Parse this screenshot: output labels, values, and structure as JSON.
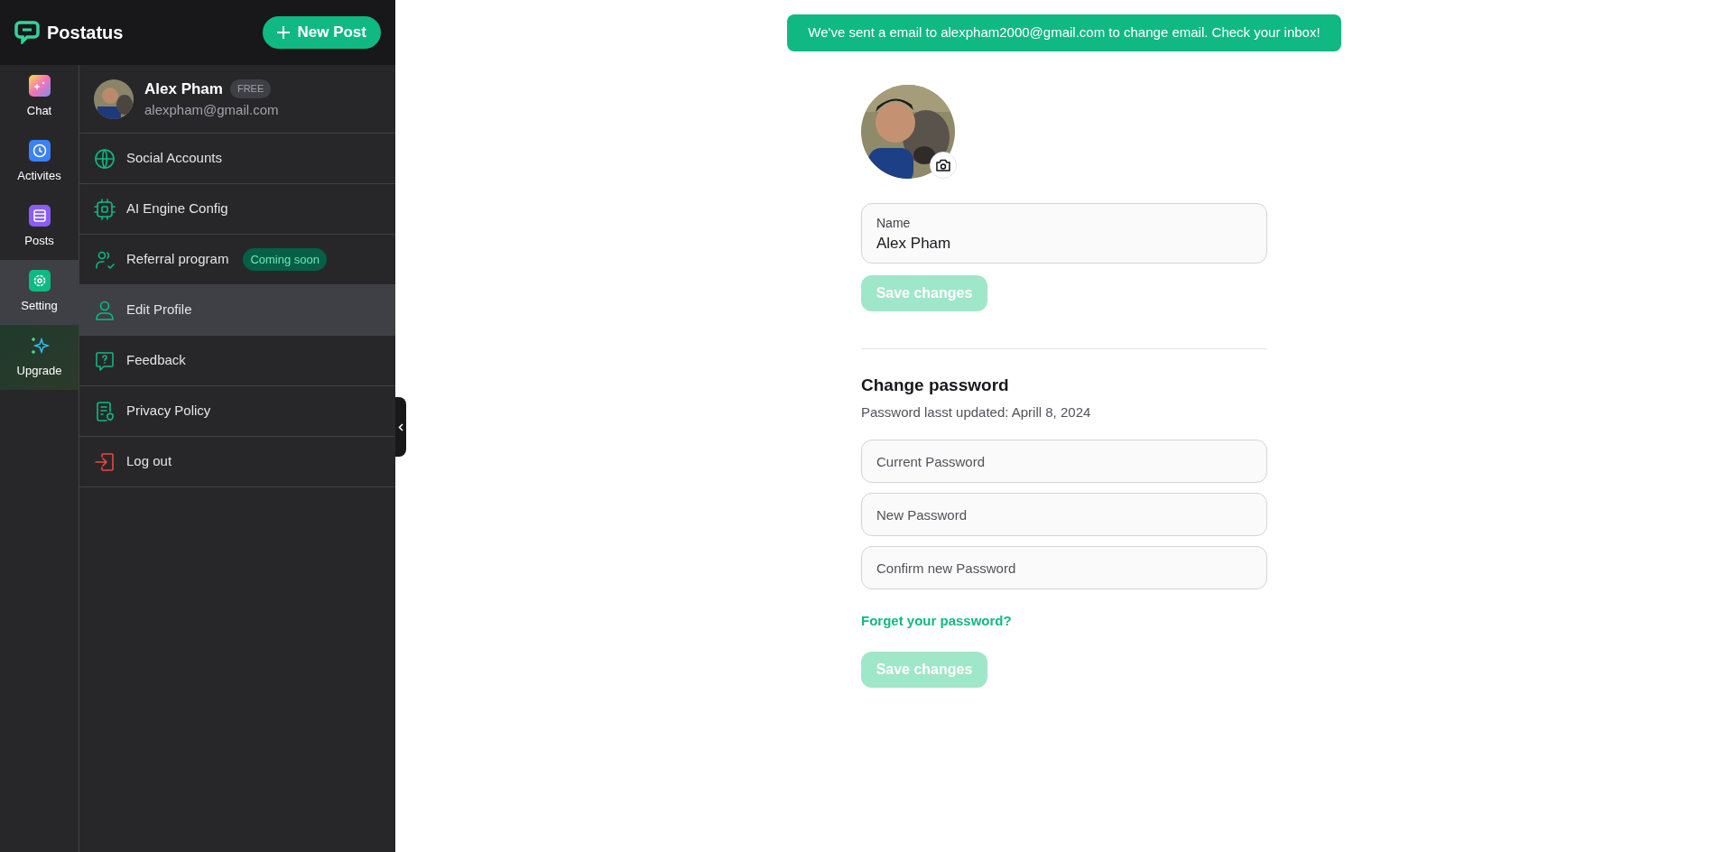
{
  "brand": {
    "name": "Postatus"
  },
  "new_post_button": {
    "label": "New Post"
  },
  "rail": [
    {
      "label": "Chat",
      "kind": "chat",
      "selected": false
    },
    {
      "label": "Activites",
      "kind": "activities",
      "selected": false
    },
    {
      "label": "Posts",
      "kind": "posts",
      "selected": false
    },
    {
      "label": "Setting",
      "kind": "setting",
      "selected": true
    },
    {
      "label": "Upgrade",
      "kind": "upgrade",
      "selected": false
    }
  ],
  "profile": {
    "name": "Alex Pham",
    "plan": "FREE",
    "email": "alexpham@gmail.com"
  },
  "menu": [
    {
      "label": "Social Accounts",
      "kind": "globe",
      "selected": false
    },
    {
      "label": "AI Engine Config",
      "kind": "chip",
      "selected": false
    },
    {
      "label": "Referral program",
      "kind": "referral",
      "selected": false,
      "badge": "Coming soon"
    },
    {
      "label": "Edit Profile",
      "kind": "user",
      "selected": true
    },
    {
      "label": "Feedback",
      "kind": "feedback",
      "selected": false
    },
    {
      "label": "Privacy Policy",
      "kind": "policy",
      "selected": false
    },
    {
      "label": "Log out",
      "kind": "logout",
      "selected": false
    }
  ],
  "toast": {
    "text": "We've sent a email to alexpham2000@gmail.com to change email. Check your inbox!"
  },
  "edit_profile": {
    "name_field": {
      "label": "Name",
      "value": "Alex Pham"
    },
    "save_button": {
      "label": "Save changes",
      "disabled": true
    }
  },
  "change_password": {
    "title": "Change password",
    "subtitle": "Password lasst updated: Aprill 8, 2024",
    "fields": [
      {
        "placeholder": "Current Password"
      },
      {
        "placeholder": "New Password"
      },
      {
        "placeholder": "Confirm new Password"
      }
    ],
    "forgot_link": "Forget your password?",
    "save_button": {
      "label": "Save changes",
      "disabled": true
    }
  }
}
